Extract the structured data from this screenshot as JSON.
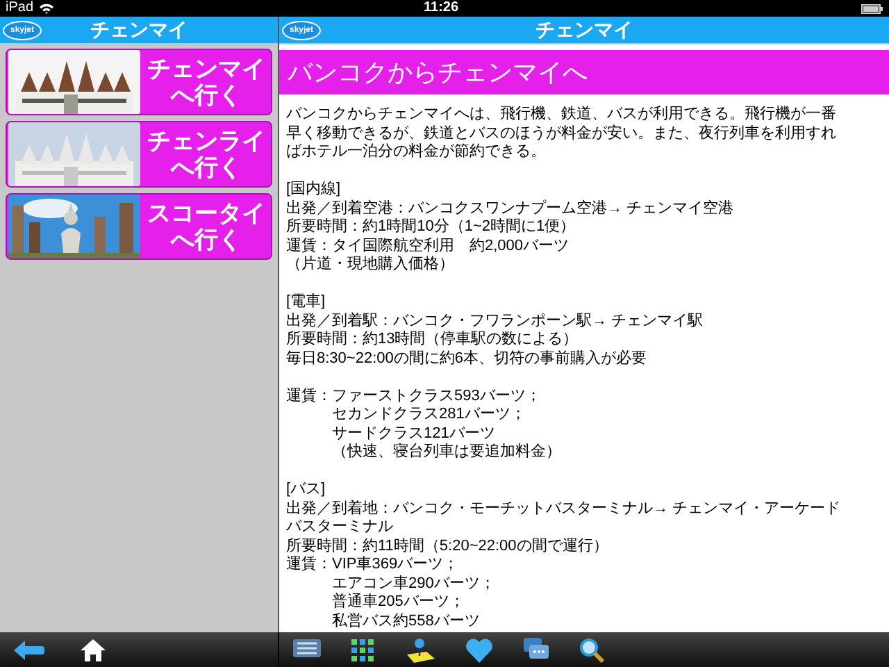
{
  "status_bar": {
    "device": "iPad",
    "time": "11:26"
  },
  "sidebar": {
    "logo": "skyjet",
    "title": "チェンマイ",
    "items": [
      {
        "label": "チェンマイへ行く"
      },
      {
        "label": "チェンライへ行く"
      },
      {
        "label": "スコータイへ行く"
      }
    ]
  },
  "detail": {
    "logo": "skyjet",
    "title": "チェンマイ",
    "heading": "バンコクからチェンマイへ",
    "intro": "バンコクからチェンマイへは、飛行機、鉄道、バスが利用できる。飛行機が一番早く移動できるが、鉄道とバスのほうが料金が安い。また、夜行列車を利用すればホテル一泊分の料金が節約できる。",
    "sections": [
      {
        "heading": "[国内線]",
        "lines": [
          {
            "kind": "line",
            "text": "出発／到着空港：バンコクスワンナプーム空港→ チェンマイ空港"
          },
          {
            "kind": "line",
            "text": "所要時間：約1時間10分（1~2時間に1便）"
          },
          {
            "kind": "line",
            "text": "運賃：タイ国際航空利用　約2,000バーツ"
          },
          {
            "kind": "line",
            "text": "（片道・現地購入価格）"
          }
        ]
      },
      {
        "heading": "[電車]",
        "lines": [
          {
            "kind": "line",
            "text": "出発／到着駅：バンコク・フワランポーン駅→ チェンマイ駅"
          },
          {
            "kind": "line",
            "text": "所要時間：約13時間（停車駅の数による）"
          },
          {
            "kind": "line",
            "text": "毎日8:30~22:00の間に約6本、切符の事前購入が必要"
          }
        ]
      },
      {
        "lines": [
          {
            "kind": "line",
            "text": "運賃：ファーストクラス593バーツ；"
          },
          {
            "kind": "indent",
            "text": "セカンドクラス281バーツ；"
          },
          {
            "kind": "indent",
            "text": "サードクラス121バーツ"
          },
          {
            "kind": "indent",
            "text": "（快速、寝台列車は要追加料金）"
          }
        ]
      },
      {
        "heading": "[バス]",
        "lines": [
          {
            "kind": "line",
            "text": "出発／到着地：バンコク・モーチットバスターミナル→ チェンマイ・アーケード"
          },
          {
            "kind": "line",
            "text": "バスターミナル"
          },
          {
            "kind": "line",
            "text": "所要時間：約11時間（5:20~22:00の間で運行）"
          },
          {
            "kind": "line",
            "text": "運賃：VIP車369バーツ；"
          },
          {
            "kind": "indent",
            "text": "エアコン車290バーツ；"
          },
          {
            "kind": "indent",
            "text": "普通車205バーツ；"
          },
          {
            "kind": "indent",
            "text": "私営バス約558バーツ"
          }
        ]
      }
    ]
  }
}
